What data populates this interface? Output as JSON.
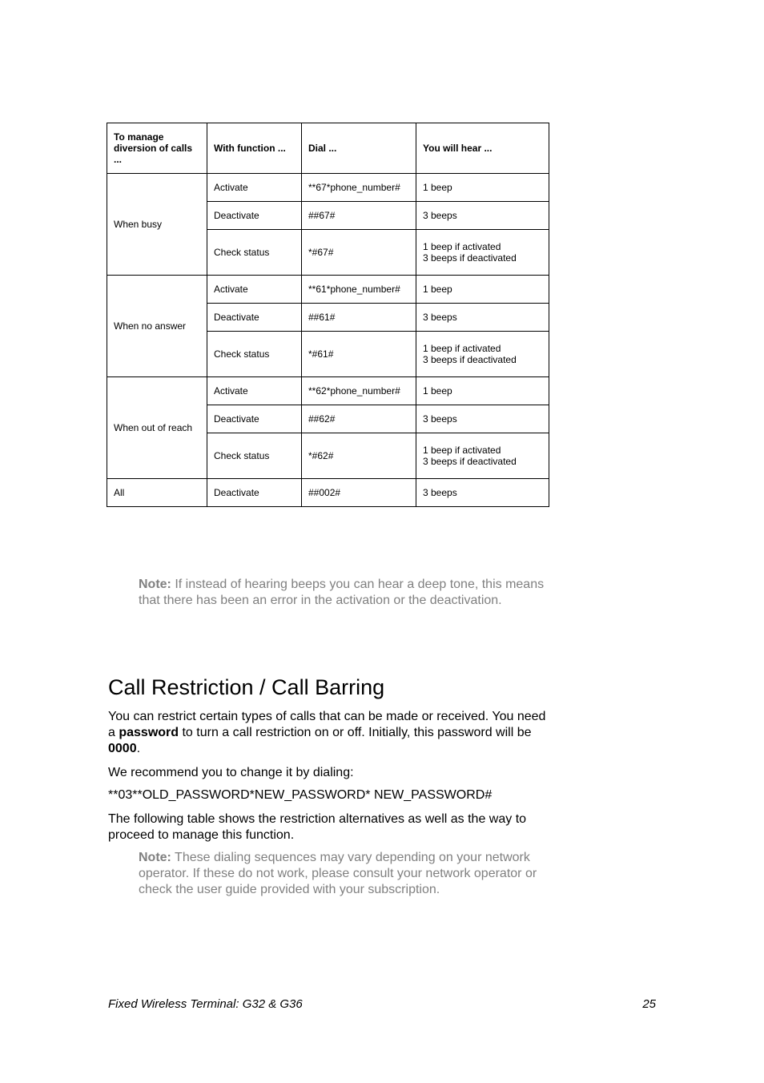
{
  "table": {
    "headers": {
      "c1": "To manage diversion of calls ...",
      "c2": "With function ...",
      "c3": "Dial ...",
      "c4": "You will hear ..."
    },
    "groups": [
      {
        "label": "When busy",
        "rows": [
          {
            "func": "Activate",
            "dial": "**67*phone_number#",
            "hear": "1 beep"
          },
          {
            "func": "Deactivate",
            "dial": "##67#",
            "hear": "3 beeps"
          },
          {
            "func": "Check status",
            "dial": "*#67#",
            "hear_line1": "1 beep if activated",
            "hear_line2": "3 beeps if deactivated"
          }
        ]
      },
      {
        "label": "When no answer",
        "rows": [
          {
            "func": "Activate",
            "dial": "**61*phone_number#",
            "hear": "1 beep"
          },
          {
            "func": "Deactivate",
            "dial": "##61#",
            "hear": "3 beeps"
          },
          {
            "func": "Check status",
            "dial": "*#61#",
            "hear_line1": "1 beep if activated",
            "hear_line2": "3 beeps if deactivated"
          }
        ]
      },
      {
        "label": "When out of reach",
        "rows": [
          {
            "func": "Activate",
            "dial": "**62*phone_number#",
            "hear": "1 beep"
          },
          {
            "func": "Deactivate",
            "dial": "##62#",
            "hear": "3 beeps"
          },
          {
            "func": "Check status",
            "dial": "*#62#",
            "hear_line1": "1 beep if activated",
            "hear_line2": "3 beeps if deactivated"
          }
        ]
      }
    ],
    "final_row": {
      "label": "All",
      "func": "Deactivate",
      "dial": "##002#",
      "hear": "3 beeps"
    }
  },
  "note1": {
    "label": "Note:",
    "text": " If instead of hearing beeps you can hear a deep tone, this means that there has been an error in the activation or the deacti­vation."
  },
  "heading": "Call Restriction / Call Barring",
  "para1_pre": "You can restrict certain types of calls that can be made or received. You need a ",
  "para1_bold1": "password",
  "para1_mid": " to turn a call restriction on or off. Initially, this pass­word will be ",
  "para1_bold2": "0000",
  "para1_post": ".",
  "para2": "We recommend you to change it by dialing:",
  "para3": "**03**OLD_PASSWORD*NEW_PASSWORD* NEW_PASSWORD#",
  "para4": "The following table shows the restriction alternatives as well as the way to proceed to manage this function.",
  "note2": {
    "label": "Note:",
    "text": " These dialing sequences may vary depending on your network operator. If these do not work, please consult your net­work operator or check the user guide provided with your sub­scription."
  },
  "footer": {
    "left": "Fixed Wireless Terminal: G32 & G36",
    "right": "25"
  }
}
